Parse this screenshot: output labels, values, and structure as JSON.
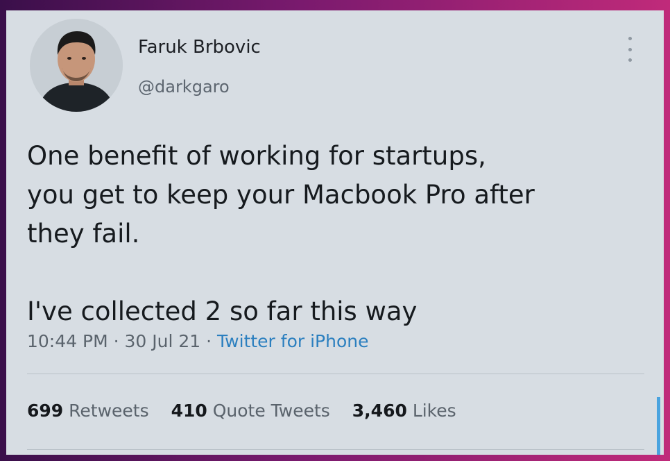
{
  "tweet": {
    "author_name": "Faruk Brbovic",
    "author_handle": "@darkgaro",
    "text_lines": [
      "One benefit of working for startups,",
      "you get to keep your Macbook Pro after",
      "they fail.",
      "I've collected 2 so far this way"
    ],
    "time": "10:44 PM",
    "date": "30 Jul 21",
    "source": "Twitter for iPhone",
    "separator": "·"
  },
  "stats": {
    "retweets_count": "699",
    "retweets_label": "Retweets",
    "quotes_count": "410",
    "quotes_label": "Quote Tweets",
    "likes_count": "3,460",
    "likes_label": "Likes"
  },
  "icons": {
    "more": "more-vertical-icon"
  },
  "colors": {
    "card_background": "#d7dde3",
    "link": "#2b7fbf",
    "text": "#161a1e",
    "muted": "#5a636c"
  }
}
